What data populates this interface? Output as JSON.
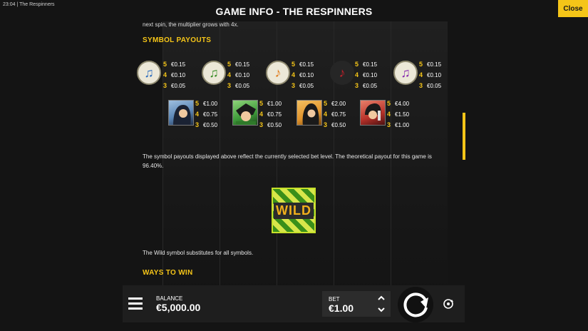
{
  "system": {
    "time": "23:04",
    "app_title": "The Respinners"
  },
  "header": {
    "title": "GAME INFO - THE RESPINNERS",
    "close_label": "Close"
  },
  "cut_text": "next spin, the multiplier grows with 4x.",
  "symbol_payouts": {
    "title": "SYMBOL PAYOUTS",
    "low_symbols": [
      {
        "name": "blue-note-symbol",
        "color": "#2f6fbf",
        "glyph": "♫",
        "p5": "€0.15",
        "p4": "€0.10",
        "p3": "€0.05"
      },
      {
        "name": "green-note-symbol",
        "color": "#3c8f2a",
        "glyph": "♫",
        "p5": "€0.15",
        "p4": "€0.10",
        "p3": "€0.05"
      },
      {
        "name": "orange-note-symbol",
        "color": "#e07a1a",
        "glyph": "♪",
        "p5": "€0.15",
        "p4": "€0.10",
        "p3": "€0.05"
      },
      {
        "name": "red-note-symbol",
        "color": "#c0202a",
        "glyph": "♪",
        "p5": "€0.15",
        "p4": "€0.10",
        "p3": "€0.05"
      },
      {
        "name": "purple-note-symbol",
        "color": "#8a2fb0",
        "glyph": "♫",
        "p5": "€0.15",
        "p4": "€0.10",
        "p3": "€0.05"
      }
    ],
    "high_symbols": [
      {
        "name": "blue-singer-symbol",
        "bg": "#5b86b5",
        "p5": "€1.00",
        "p4": "€0.75",
        "p3": "€0.50"
      },
      {
        "name": "green-singer-symbol",
        "bg": "#3e9a3a",
        "p5": "€1.00",
        "p4": "€0.75",
        "p3": "€0.50"
      },
      {
        "name": "orange-singer-symbol",
        "bg": "#e0922a",
        "p5": "€2.00",
        "p4": "€0.75",
        "p3": "€0.50"
      },
      {
        "name": "red-singer-symbol",
        "bg": "#b8322a",
        "p5": "€4.00",
        "p4": "€1.50",
        "p3": "€1.00"
      }
    ],
    "note": "The symbol payouts displayed above reflect the currently selected bet level. The theoretical payout for this game is 96.40%."
  },
  "wild": {
    "label": "WILD",
    "text": "The Wild symbol substitutes for all symbols."
  },
  "ways_to_win": {
    "title": "WAYS TO WIN"
  },
  "footer": {
    "balance_label": "BALANCE",
    "balance_value": "€5,000.00",
    "bet_label": "BET",
    "bet_value": "€1.00"
  },
  "colors": {
    "accent": "#f5c518",
    "background": "#141414"
  }
}
